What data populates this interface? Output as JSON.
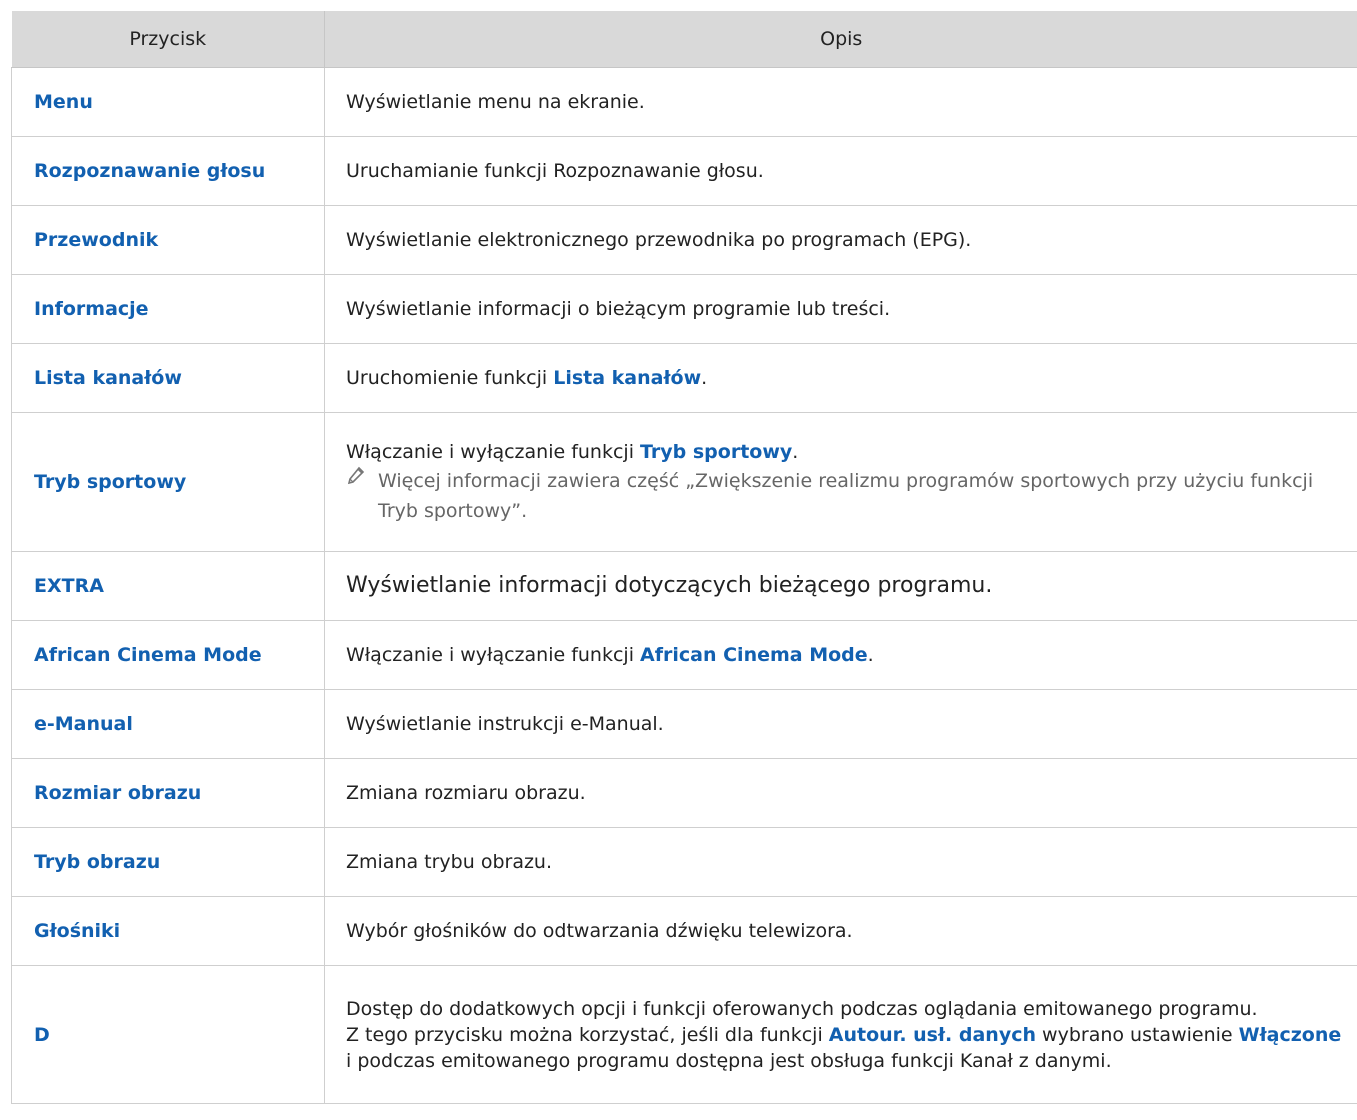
{
  "table": {
    "header": {
      "col1": "Przycisk",
      "col2": "Opis"
    },
    "rows": [
      {
        "button": "Menu",
        "desc": "Wyświetlanie menu na ekranie."
      },
      {
        "button": "Rozpoznawanie głosu",
        "desc": "Uruchamianie funkcji Rozpoznawanie głosu."
      },
      {
        "button": "Przewodnik",
        "desc": "Wyświetlanie elektronicznego przewodnika po programach (EPG)."
      },
      {
        "button": "Informacje",
        "desc": "Wyświetlanie informacji o bieżącym programie lub treści."
      },
      {
        "button": "Lista kanałów",
        "desc_pre": "Uruchomienie funkcji ",
        "desc_hl": "Lista kanałów",
        "desc_post": "."
      },
      {
        "button": "Tryb sportowy",
        "desc_pre": "Włączanie i wyłączanie funkcji ",
        "desc_hl": "Tryb sportowy",
        "desc_post": ".",
        "note": "Więcej informacji zawiera część „Zwiększenie realizmu programów sportowych przy użyciu funkcji Tryb sportowy”.",
        "note_icon": "pencil-icon"
      },
      {
        "button": "EXTRA",
        "desc": "Wyświetlanie informacji dotyczących bieżącego programu."
      },
      {
        "button": "African Cinema Mode",
        "desc_pre": "Włączanie i wyłączanie funkcji ",
        "desc_hl": "African Cinema Mode",
        "desc_post": "."
      },
      {
        "button": "e-Manual",
        "desc": "Wyświetlanie instrukcji e-Manual."
      },
      {
        "button": "Rozmiar obrazu",
        "desc": "Zmiana rozmiaru obrazu."
      },
      {
        "button": "Tryb obrazu",
        "desc": "Zmiana trybu obrazu."
      },
      {
        "button": "Głośniki",
        "desc": "Wybór głośników do odtwarzania dźwięku telewizora."
      },
      {
        "button": "D",
        "desc_line1": "Dostęp do dodatkowych opcji i funkcji oferowanych podczas oglądania emitowanego programu.",
        "desc_line2_pre": "Z tego przycisku można korzystać, jeśli dla funkcji ",
        "desc_line2_hl1": "Autour. usł. danych",
        "desc_line2_mid": " wybrano ustawienie ",
        "desc_line2_hl2": "Włączone",
        "desc_line2_post": " i podczas emitowanego programu dostępna jest obsługa funkcji Kanał z danymi."
      }
    ]
  },
  "colors": {
    "link": "#1260b0",
    "header_bg": "#d9d9d9",
    "note_text": "#666666"
  }
}
